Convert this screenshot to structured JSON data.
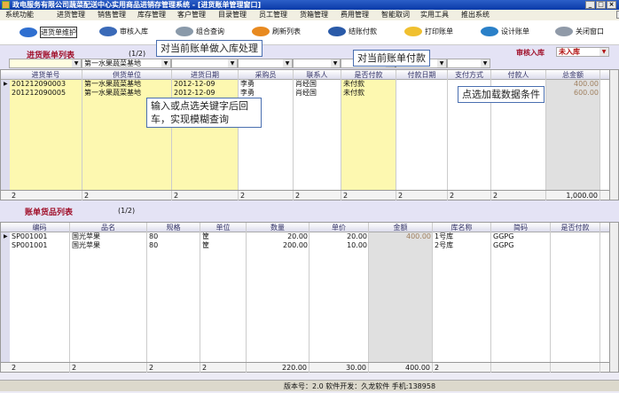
{
  "window": {
    "title": "政电服务有限公司蔬菜配送中心实用商品进销存管理系统 - [进货账单管理窗口]"
  },
  "menu": [
    "系统功能",
    "进货管理",
    "销售管理",
    "库存管理",
    "客户管理",
    "目录管理",
    "员工管理",
    "货箱管理",
    "费用管理",
    "智能取词",
    "实用工具",
    "推出系统"
  ],
  "toolbar": [
    {
      "label": "进货单维护",
      "color": "#2f6fd0"
    },
    {
      "label": "审核入库",
      "color": "#3a6ab8"
    },
    {
      "label": "组合查询",
      "color": "#8a9aaa"
    },
    {
      "label": "刷新列表",
      "color": "#e88a20"
    },
    {
      "label": "结账付款",
      "color": "#2a5aa8"
    },
    {
      "label": "打印账单",
      "color": "#f0c030"
    },
    {
      "label": "设计账单",
      "color": "#2a80c8"
    },
    {
      "label": "关闭窗口",
      "color": "#909aa8"
    }
  ],
  "bills": {
    "title": "进货账单列表",
    "page": "(1/2)",
    "audit_label": "审核入库",
    "audit_value": "未入库",
    "filter_supplier": "第一水果蔬菜基地",
    "columns": [
      "进货单号",
      "供货单位",
      "进货日期",
      "采购员",
      "联系人",
      "是否付款",
      "付款日期",
      "支付方式",
      "付款人",
      "总金额"
    ],
    "rows": [
      [
        "201212090003",
        "第一水果蔬菜基地",
        "2012-12-09",
        "李勇",
        "肖经国",
        "未付款",
        "",
        "",
        "",
        "400.00"
      ],
      [
        "201212090005",
        "第一水果蔬菜基地",
        "2012-12-09",
        "李勇",
        "肖经国",
        "未付款",
        "",
        "",
        "",
        "600.00"
      ]
    ],
    "footer": [
      "2",
      "2",
      "2",
      "2",
      "2",
      "2",
      "2",
      "2",
      "2",
      "1,000.00"
    ]
  },
  "items": {
    "title": "账单货品列表",
    "page": "(1/2)",
    "columns": [
      "编码",
      "品名",
      "规格",
      "单位",
      "数量",
      "单价",
      "金额",
      "库名称",
      "简码",
      "是否付款"
    ],
    "rows": [
      [
        "SP001001",
        "国光苹果",
        "80",
        "筐",
        "20.00",
        "20.00",
        "400.00",
        "1号库",
        "GGPG",
        ""
      ],
      [
        "SP001001",
        "国光苹果",
        "80",
        "筐",
        "200.00",
        "10.00",
        "",
        "2号库",
        "GGPG",
        ""
      ]
    ],
    "footer": [
      "2",
      "2",
      "2",
      "2",
      "220.00",
      "30.00",
      "400.00",
      "2",
      "",
      ""
    ]
  },
  "callouts": {
    "audit": "对当前账单做入库处理",
    "pay": "对当前账单付款",
    "search": "输入或点选关键字后回车，实现模糊查询",
    "load": "点选加载数据条件"
  },
  "status": "版本号：2.0  软件开发：久龙软件  手机:138958"
}
